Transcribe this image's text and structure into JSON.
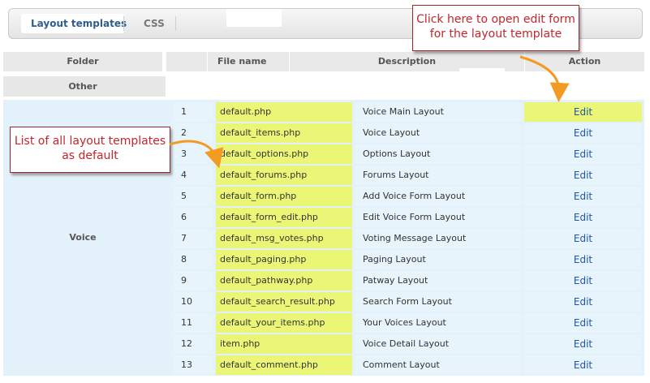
{
  "tabs": {
    "layout_templates": "Layout templates",
    "css": "CSS"
  },
  "table": {
    "headers": {
      "folder": "Folder",
      "file_name": "File name",
      "description": "Description",
      "action": "Action"
    },
    "other_folder": "Other",
    "voice_folder": "Voice",
    "rows": [
      {
        "num": "1",
        "file": "default.php",
        "desc": "Voice Main Layout",
        "action": "Edit"
      },
      {
        "num": "2",
        "file": "default_items.php",
        "desc": "Voice Layout",
        "action": "Edit"
      },
      {
        "num": "3",
        "file": "default_options.php",
        "desc": "Options Layout",
        "action": "Edit"
      },
      {
        "num": "4",
        "file": "default_forums.php",
        "desc": "Forums Layout",
        "action": "Edit"
      },
      {
        "num": "5",
        "file": "default_form.php",
        "desc": "Add Voice Form Layout",
        "action": "Edit"
      },
      {
        "num": "6",
        "file": "default_form_edit.php",
        "desc": "Edit Voice Form Layout",
        "action": "Edit"
      },
      {
        "num": "7",
        "file": "default_msg_votes.php",
        "desc": "Voting Message Layout",
        "action": "Edit"
      },
      {
        "num": "8",
        "file": "default_paging.php",
        "desc": "Paging Layout",
        "action": "Edit"
      },
      {
        "num": "9",
        "file": "default_pathway.php",
        "desc": "Patway Layout",
        "action": "Edit"
      },
      {
        "num": "10",
        "file": "default_search_result.php",
        "desc": "Search Form Layout",
        "action": "Edit"
      },
      {
        "num": "11",
        "file": "default_your_items.php",
        "desc": "Your Voices Layout",
        "action": "Edit"
      },
      {
        "num": "12",
        "file": "item.php",
        "desc": "Voice Detail Layout",
        "action": "Edit"
      },
      {
        "num": "13",
        "file": "default_comment.php",
        "desc": "Comment Layout",
        "action": "Edit"
      }
    ]
  },
  "callouts": {
    "edit_line1": "Click here to open edit form",
    "edit_line2": "for the layout template",
    "list_line1": "List of all layout templates",
    "list_line2": "as default"
  },
  "colors": {
    "highlight": "#ebf676",
    "voice_bg": "#e3f1fb",
    "link": "#1f56a8",
    "callout_text": "#c0272d",
    "arrow": "#f39a23"
  }
}
